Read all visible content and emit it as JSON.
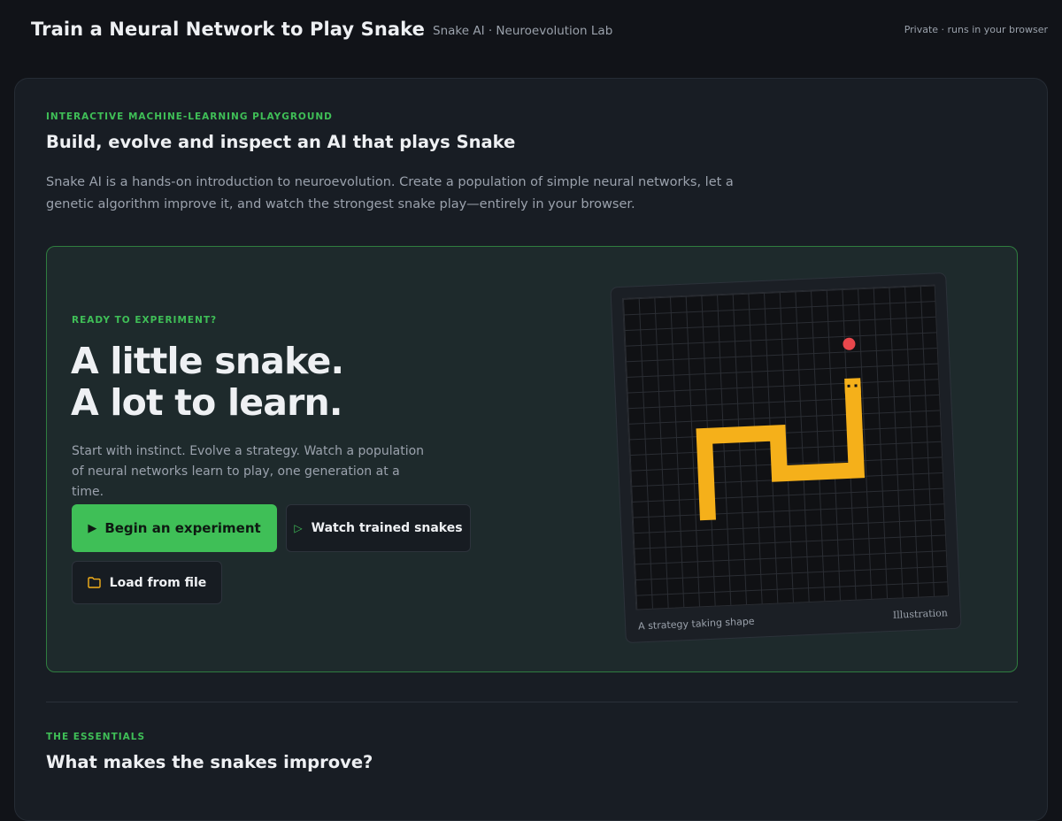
{
  "header": {
    "title": "Train a Neural Network to Play Snake",
    "subtitle": "Snake AI · Neuroevolution Lab",
    "privacy_note": "Private · runs in your browser"
  },
  "intro": {
    "eyebrow": "INTERACTIVE MACHINE-LEARNING PLAYGROUND",
    "heading": "Build, evolve and inspect an AI that plays Snake",
    "description": "Snake AI is a hands-on introduction to neuroevolution. Create a population of simple neural networks, let a genetic algorithm improve it, and watch the strongest snake play—entirely in your browser."
  },
  "hero": {
    "eyebrow": "READY TO EXPERIMENT?",
    "headline_line1": "A little snake.",
    "headline_line2": "A lot to learn.",
    "description": "Start with instinct. Evolve a strategy. Watch a population of neural networks learn to play, one generation at a time.",
    "buttons": {
      "begin": "Begin an experiment",
      "watch": "Watch trained snakes",
      "load": "Load from file"
    },
    "illustration": {
      "caption": "A strategy taking shape",
      "tag": "Illustration"
    }
  },
  "essentials": {
    "eyebrow": "THE ESSENTIALS",
    "heading": "What makes the snakes improve?"
  },
  "colors": {
    "accent": "#3fbf57",
    "snake": "#f5b01a",
    "food": "#e8474c",
    "board": "#101114"
  },
  "icons": {
    "begin": "play-icon",
    "watch": "play-outline-icon",
    "load": "folder-icon"
  }
}
